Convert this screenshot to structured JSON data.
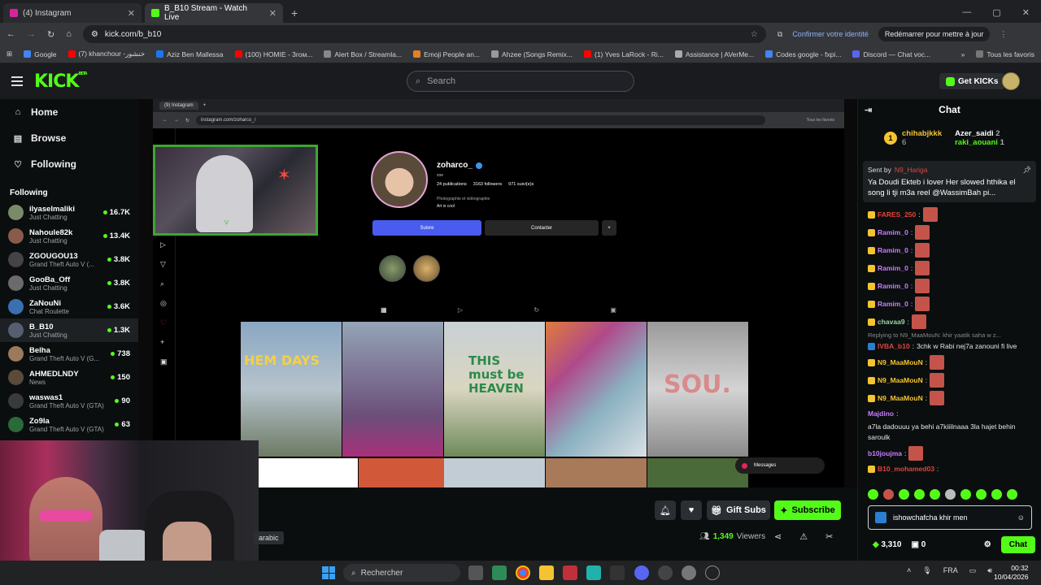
{
  "browser": {
    "tabs": [
      {
        "title": "(4) Instagram",
        "active": false
      },
      {
        "title": "B_B10 Stream - Watch Live",
        "active": true
      }
    ],
    "url": "kick.com/b_b10",
    "identity": "Confirmer votre identité",
    "restart": "Redémarrer pour mettre à jour",
    "bookmarks": [
      "Google",
      "(7) khanchour -خنشور",
      "Aziz Ben Mallessa",
      "(100) HOMIE - 3roм...",
      "Alert Box / Streamla...",
      "Emoji People an...",
      "Ahzee (Songs Remix...",
      "(1) Yves LaRock - Ri...",
      "Assistance | AVerMe...",
      "Codes google - fxpi...",
      "Discord — Chat voc..."
    ],
    "all_favs": "Tous les favoris"
  },
  "kick": {
    "search_placeholder": "Search",
    "get_kicks": "Get KICKs",
    "nav": [
      {
        "label": "Home",
        "icon": "home-icon"
      },
      {
        "label": "Browse",
        "icon": "browse-icon"
      },
      {
        "label": "Following",
        "icon": "heart-icon"
      }
    ],
    "following_title": "Following",
    "channels": [
      {
        "name": "ilyaselmaliki",
        "category": "Just Chatting",
        "viewers": "16.7K",
        "color": "#7a8b6a"
      },
      {
        "name": "Nahoule82k",
        "category": "Just Chatting",
        "viewers": "13.4K",
        "color": "#8a5a4a"
      },
      {
        "name": "ZGOUGOU13",
        "category": "Grand Theft Auto V (...",
        "viewers": "3.8K",
        "color": "#444"
      },
      {
        "name": "GooBa_Off",
        "category": "Just Chatting",
        "viewers": "3.8K",
        "color": "#6b6b6b"
      },
      {
        "name": "ZaNouNi",
        "category": "Chat Roulette",
        "viewers": "3.6K",
        "color": "#3a6fb0"
      },
      {
        "name": "B_B10",
        "category": "Just Chatting",
        "viewers": "1.3K",
        "color": "#555f70"
      },
      {
        "name": "Belha",
        "category": "Grand Theft Auto V (G...",
        "viewers": "738",
        "color": "#9a7a5a"
      },
      {
        "name": "AHMEDLNDY",
        "category": "News",
        "viewers": "150",
        "color": "#5a4a3a"
      },
      {
        "name": "waswas1",
        "category": "Grand Theft Auto V (GTA)",
        "viewers": "90",
        "color": "#3a3a3a"
      },
      {
        "name": "Zo9la",
        "category": "Grand Theft Auto V (GTA)",
        "viewers": "63",
        "color": "#2a6a3a"
      }
    ]
  },
  "stream": {
    "ig_tab": "(9) Instagram",
    "ig_url": "instagram.com/zoharco_/",
    "ig_favs": "Tous les favoris",
    "profile": {
      "username": "zoharco_",
      "sub": "zoe",
      "posts": "24 publications",
      "followers": "3163 followers",
      "following": "971 suivi(e)s",
      "bio1": "Photographie et vidéographie",
      "bio2": "Art is cool",
      "follow_btn": "Suivre",
      "contact_btn": "Contacter"
    },
    "tiles": [
      "HEM DAYS",
      "THIS must be HEAVEN",
      "SOU."
    ],
    "messages_label": "Messages",
    "language_tag": "arabic",
    "gift_subs": "Gift Subs",
    "subscribe": "Subscribe",
    "viewers": "1,349",
    "viewers_label": "Viewers"
  },
  "chat": {
    "title": "Chat",
    "leaderboard": [
      {
        "rank": "1",
        "user": "chihabjkkk",
        "count": "6"
      },
      {
        "user": "Azer_saidi",
        "count": "2"
      },
      {
        "user": "raki_aouani",
        "count": "1"
      }
    ],
    "pinned": {
      "sent_by": "Sent by",
      "user": "N9_Hariga",
      "text": "Ya Doudi Ekteb i lover Her slowed hthika el song li tji m3a reel @WassimBah pi..."
    },
    "messages": [
      {
        "user": "FARES_250",
        "color": "#e0443c",
        "text": ":"
      },
      {
        "user": "Ramim_0",
        "color": "#c77dff",
        "text": ":"
      },
      {
        "user": "Ramim_0",
        "color": "#c77dff",
        "text": ":"
      },
      {
        "user": "Ramim_0",
        "color": "#c77dff",
        "text": ":"
      },
      {
        "user": "Ramim_0",
        "color": "#c77dff",
        "text": ":"
      },
      {
        "user": "Ramim_0",
        "color": "#c77dff",
        "text": ":"
      },
      {
        "user": "chavaa9",
        "color": "#9ad6a0",
        "text": ":"
      }
    ],
    "reply_to": "Replying to N9_MaaMouN: khir yaatik saha w z...",
    "reply_user": "IVBA_b10",
    "reply_text": "3chk w Rabi nej7a zanouni fi live",
    "messages2": [
      {
        "user": "N9_MaaMouN",
        "color": "#f4c430",
        "text": ":"
      },
      {
        "user": "N9_MaaMouN",
        "color": "#f4c430",
        "text": ":"
      },
      {
        "user": "N9_MaaMouN",
        "color": "#f4c430",
        "text": ":"
      }
    ],
    "majdino_user": "Majdino",
    "majdino_text": "a7la dadouuu ya behi a7kiiilnaaa 3la hajet behin saroulk",
    "b10_user": "b10joujma",
    "b10mo_user": "B10_mohamed03",
    "input_value": "ishowchafcha khir men",
    "kicks": "3,310",
    "points": "0",
    "send": "Chat"
  },
  "taskbar": {
    "search": "Rechercher",
    "lang": "FRA",
    "time": "00:32",
    "date": "10/04/2026"
  }
}
